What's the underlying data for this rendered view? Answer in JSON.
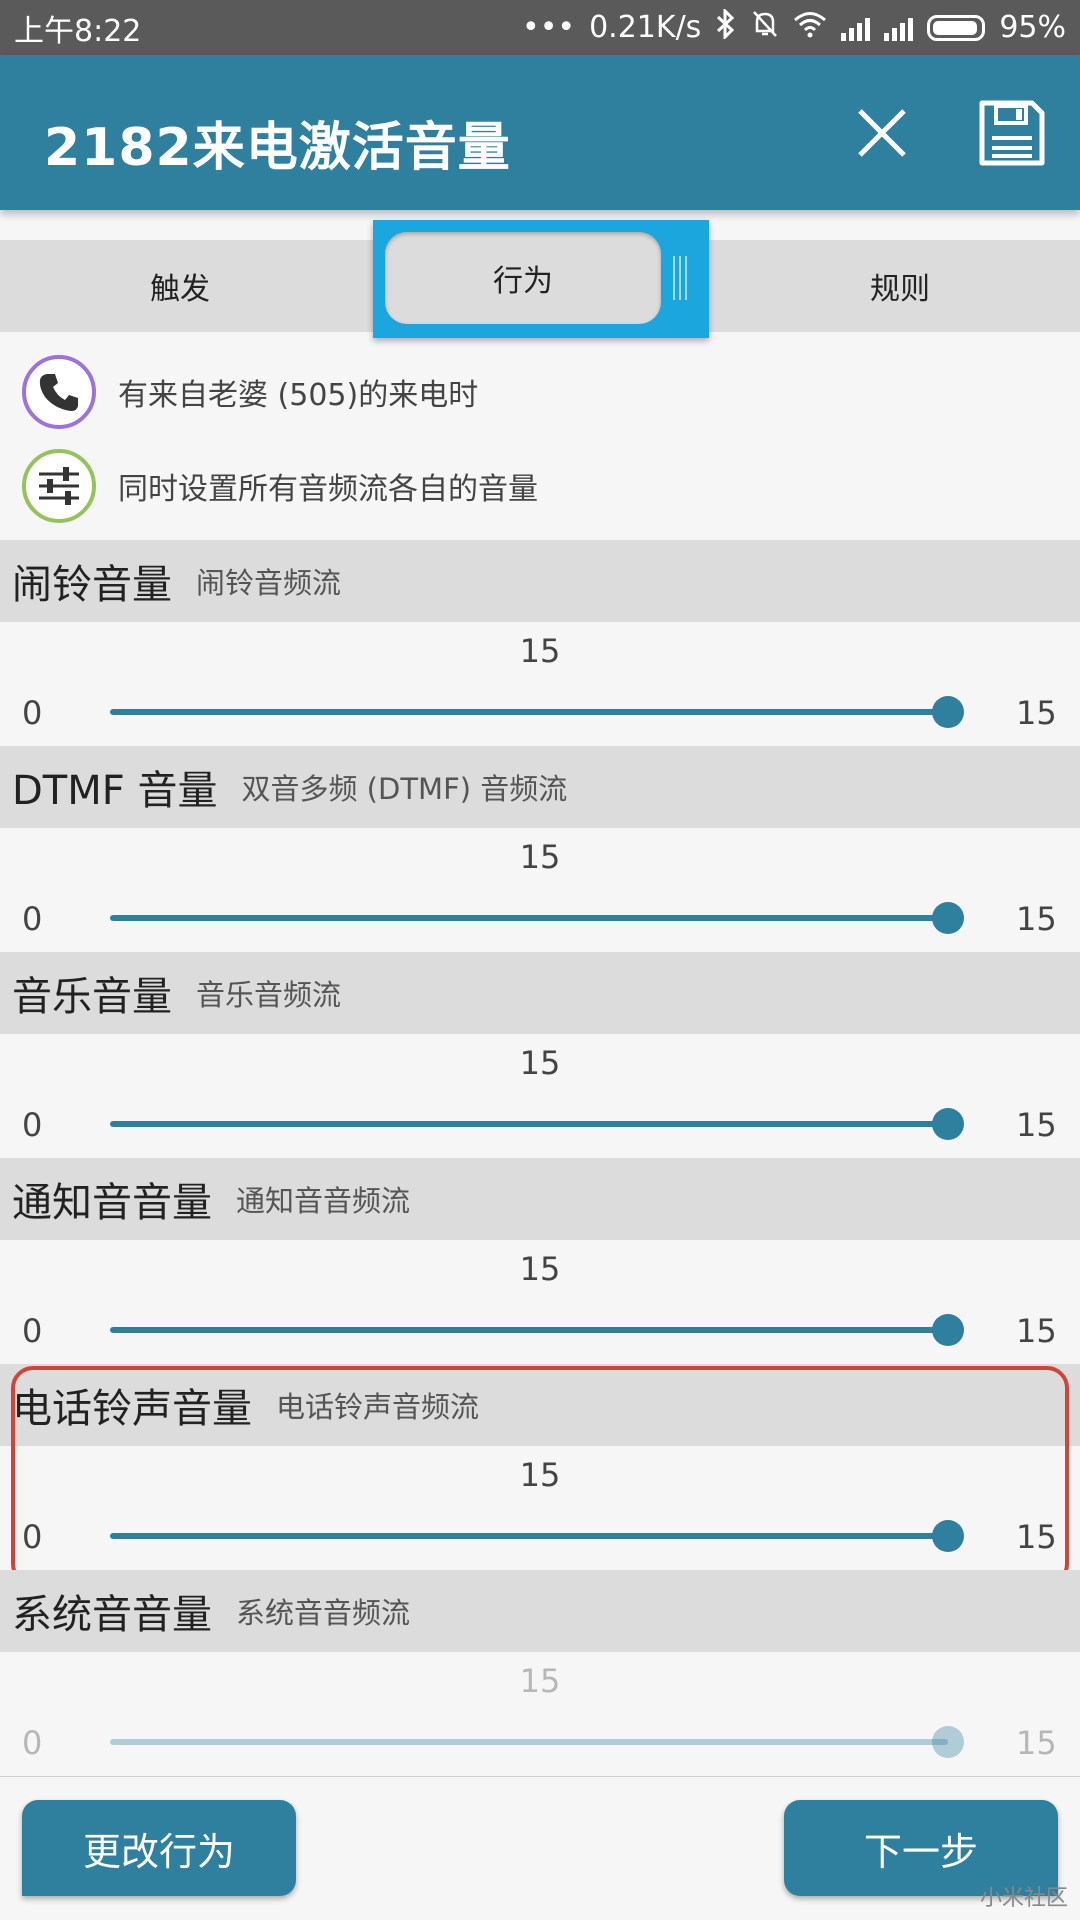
{
  "status_bar": {
    "time": "上午8:22",
    "dots": "•••",
    "speed": "0.21K/s",
    "battery": "95%"
  },
  "app_bar": {
    "title": "2182来电激活音量"
  },
  "tabs": [
    {
      "label": "触发"
    },
    {
      "label": "行为",
      "active": true
    },
    {
      "label": "规则"
    }
  ],
  "summary": [
    {
      "icon": "phone-icon",
      "text": "有来自老婆 (505)的来电时"
    },
    {
      "icon": "equalizer-icon",
      "text": "同时设置所有音频流各自的音量"
    }
  ],
  "sections": [
    {
      "title": "闹铃音量",
      "subtitle": "闹铃音频流",
      "value": "15",
      "min": "0",
      "max": "15"
    },
    {
      "title": "DTMF 音量",
      "subtitle": "双音多频 (DTMF) 音频流",
      "value": "15",
      "min": "0",
      "max": "15"
    },
    {
      "title": "音乐音量",
      "subtitle": "音乐音频流",
      "value": "15",
      "min": "0",
      "max": "15"
    },
    {
      "title": "通知音音量",
      "subtitle": "通知音音频流",
      "value": "15",
      "min": "0",
      "max": "15"
    },
    {
      "title": "电话铃声音量",
      "subtitle": "电话铃声音频流",
      "value": "15",
      "min": "0",
      "max": "15",
      "highlighted": true
    },
    {
      "title": "系统音音量",
      "subtitle": "系统音音频流",
      "value": "15",
      "min": "0",
      "max": "15"
    }
  ],
  "buttons": {
    "change_behavior": "更改行为",
    "next": "下一步"
  },
  "watermark": "小米社区",
  "colors": {
    "primary": "#2f7f9e",
    "tab_highlight": "#1ba6de",
    "annotation_red": "#d0443a"
  }
}
